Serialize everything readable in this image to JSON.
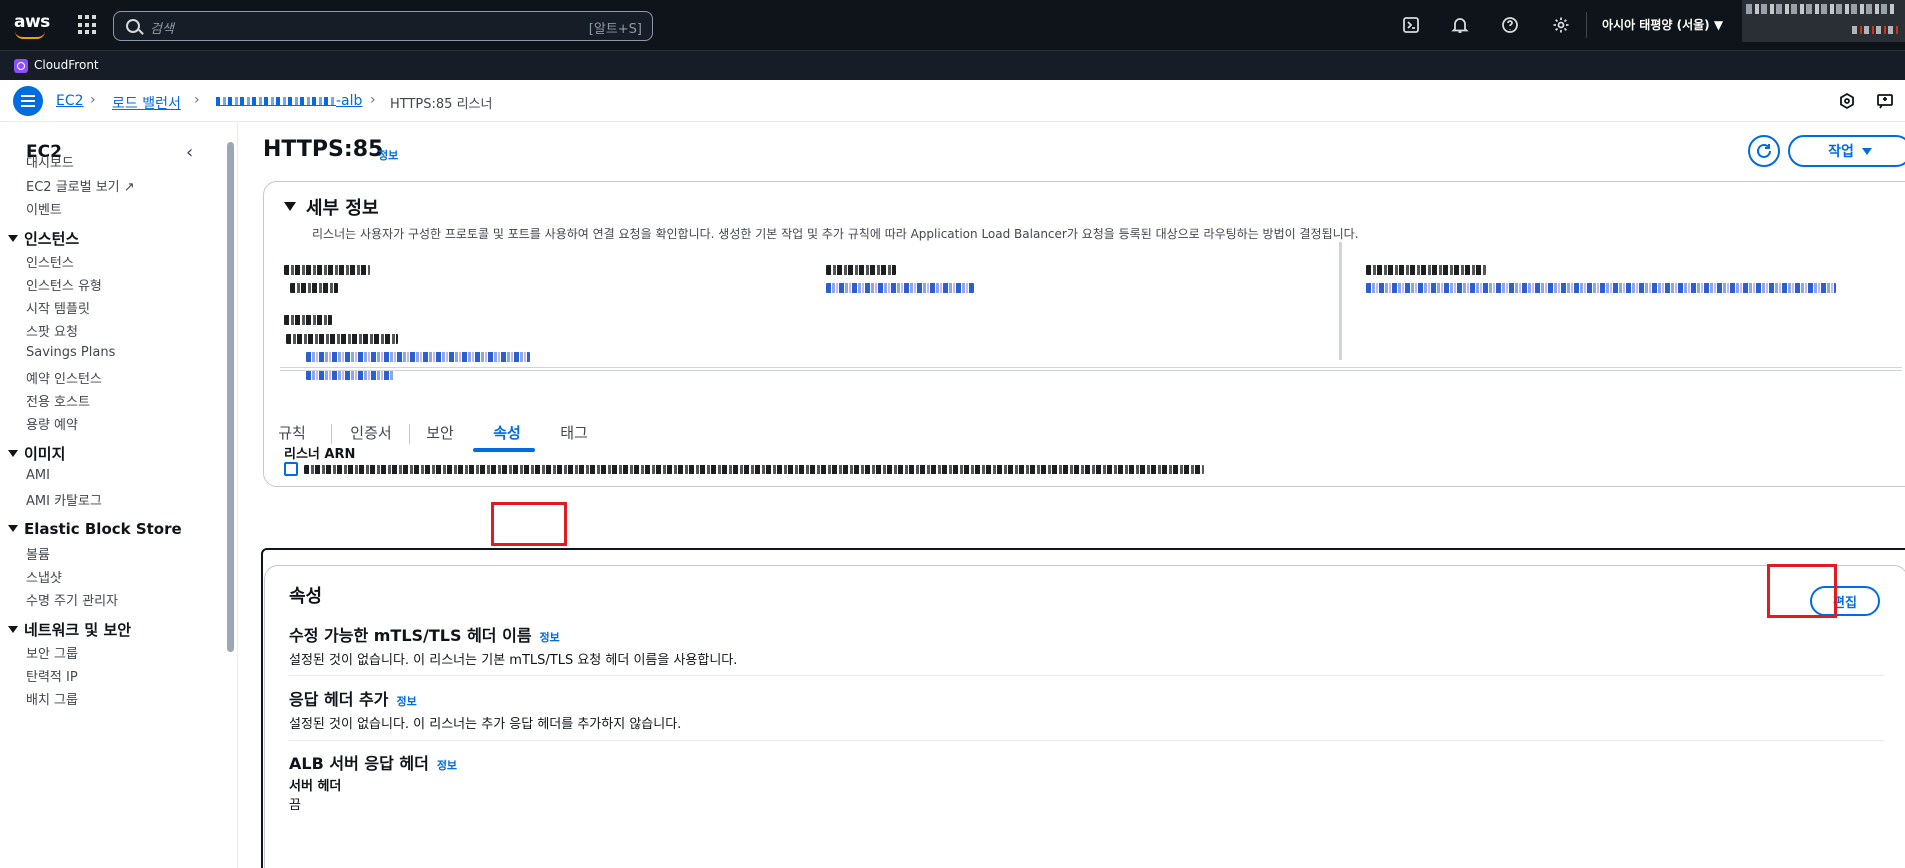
{
  "topnav": {
    "logo": "aws",
    "search_placeholder": "검색",
    "search_shortcut": "[알트+S]",
    "region": "아시아 태평양 (서울)",
    "icons": [
      "cloudshell-icon",
      "bell-icon",
      "help-icon",
      "gear-icon"
    ]
  },
  "servicebar": {
    "label": "CloudFront"
  },
  "breadcrumb": {
    "items": [
      {
        "label": "EC2"
      },
      {
        "label": "로드 밸런서"
      },
      {
        "label": "-alb"
      },
      {
        "label": "HTTPS:85 리스너"
      }
    ]
  },
  "sidebar": {
    "title": "EC2",
    "top_items": [
      "대시보드",
      "EC2 글로벌 보기",
      "이벤트"
    ],
    "sections": [
      {
        "title": "인스턴스",
        "items": [
          "인스턴스",
          "인스턴스 유형",
          "시작 템플릿",
          "스팟 요청",
          "Savings Plans",
          "예약 인스턴스",
          "전용 호스트",
          "용량 예약"
        ]
      },
      {
        "title": "이미지",
        "items": [
          "AMI",
          "AMI 카탈로그"
        ]
      },
      {
        "title": "Elastic Block Store",
        "items": [
          "볼륨",
          "스냅샷",
          "수명 주기 관리자"
        ]
      },
      {
        "title": "네트워크 및 보안",
        "items": [
          "보안 그룹",
          "탄력적 IP",
          "배치 그룹"
        ]
      }
    ]
  },
  "page": {
    "title": "HTTPS:85",
    "info": "정보",
    "action_label": "작업"
  },
  "details": {
    "heading": "세부 정보",
    "description": "리스너는 사용자가 구성한 프로토콜 및 포트를 사용하여 연결 요청을 확인합니다. 생성한 기본 작업 및 추가 규칙에 따라 Application Load Balancer가 요청을 등록된 대상으로 라우팅하는 방법이 결정됩니다.",
    "arn_label": "리스너 ARN"
  },
  "tabs": [
    "규칙",
    "인증서",
    "보안",
    "속성",
    "태그"
  ],
  "active_tab": "속성",
  "properties": {
    "title": "속성",
    "edit_label": "편집",
    "sections": [
      {
        "title": "수정 가능한 mTLS/TLS 헤더 이름",
        "info": "정보",
        "desc": "설정된 것이 없습니다. 이 리스너는 기본 mTLS/TLS 요청 헤더 이름을 사용합니다."
      },
      {
        "title": "응답 헤더 추가",
        "info": "정보",
        "desc": "설정된 것이 없습니다. 이 리스너는 추가 응답 헤더를 추가하지 않습니다."
      },
      {
        "title": "ALB 서버 응답 헤더",
        "info": "정보",
        "kv_label": "서버 헤더",
        "kv_value": "끔"
      }
    ]
  },
  "colors": {
    "accent": "#006ce0",
    "highlight": "#e01b24",
    "topnav": "#0f141a"
  }
}
